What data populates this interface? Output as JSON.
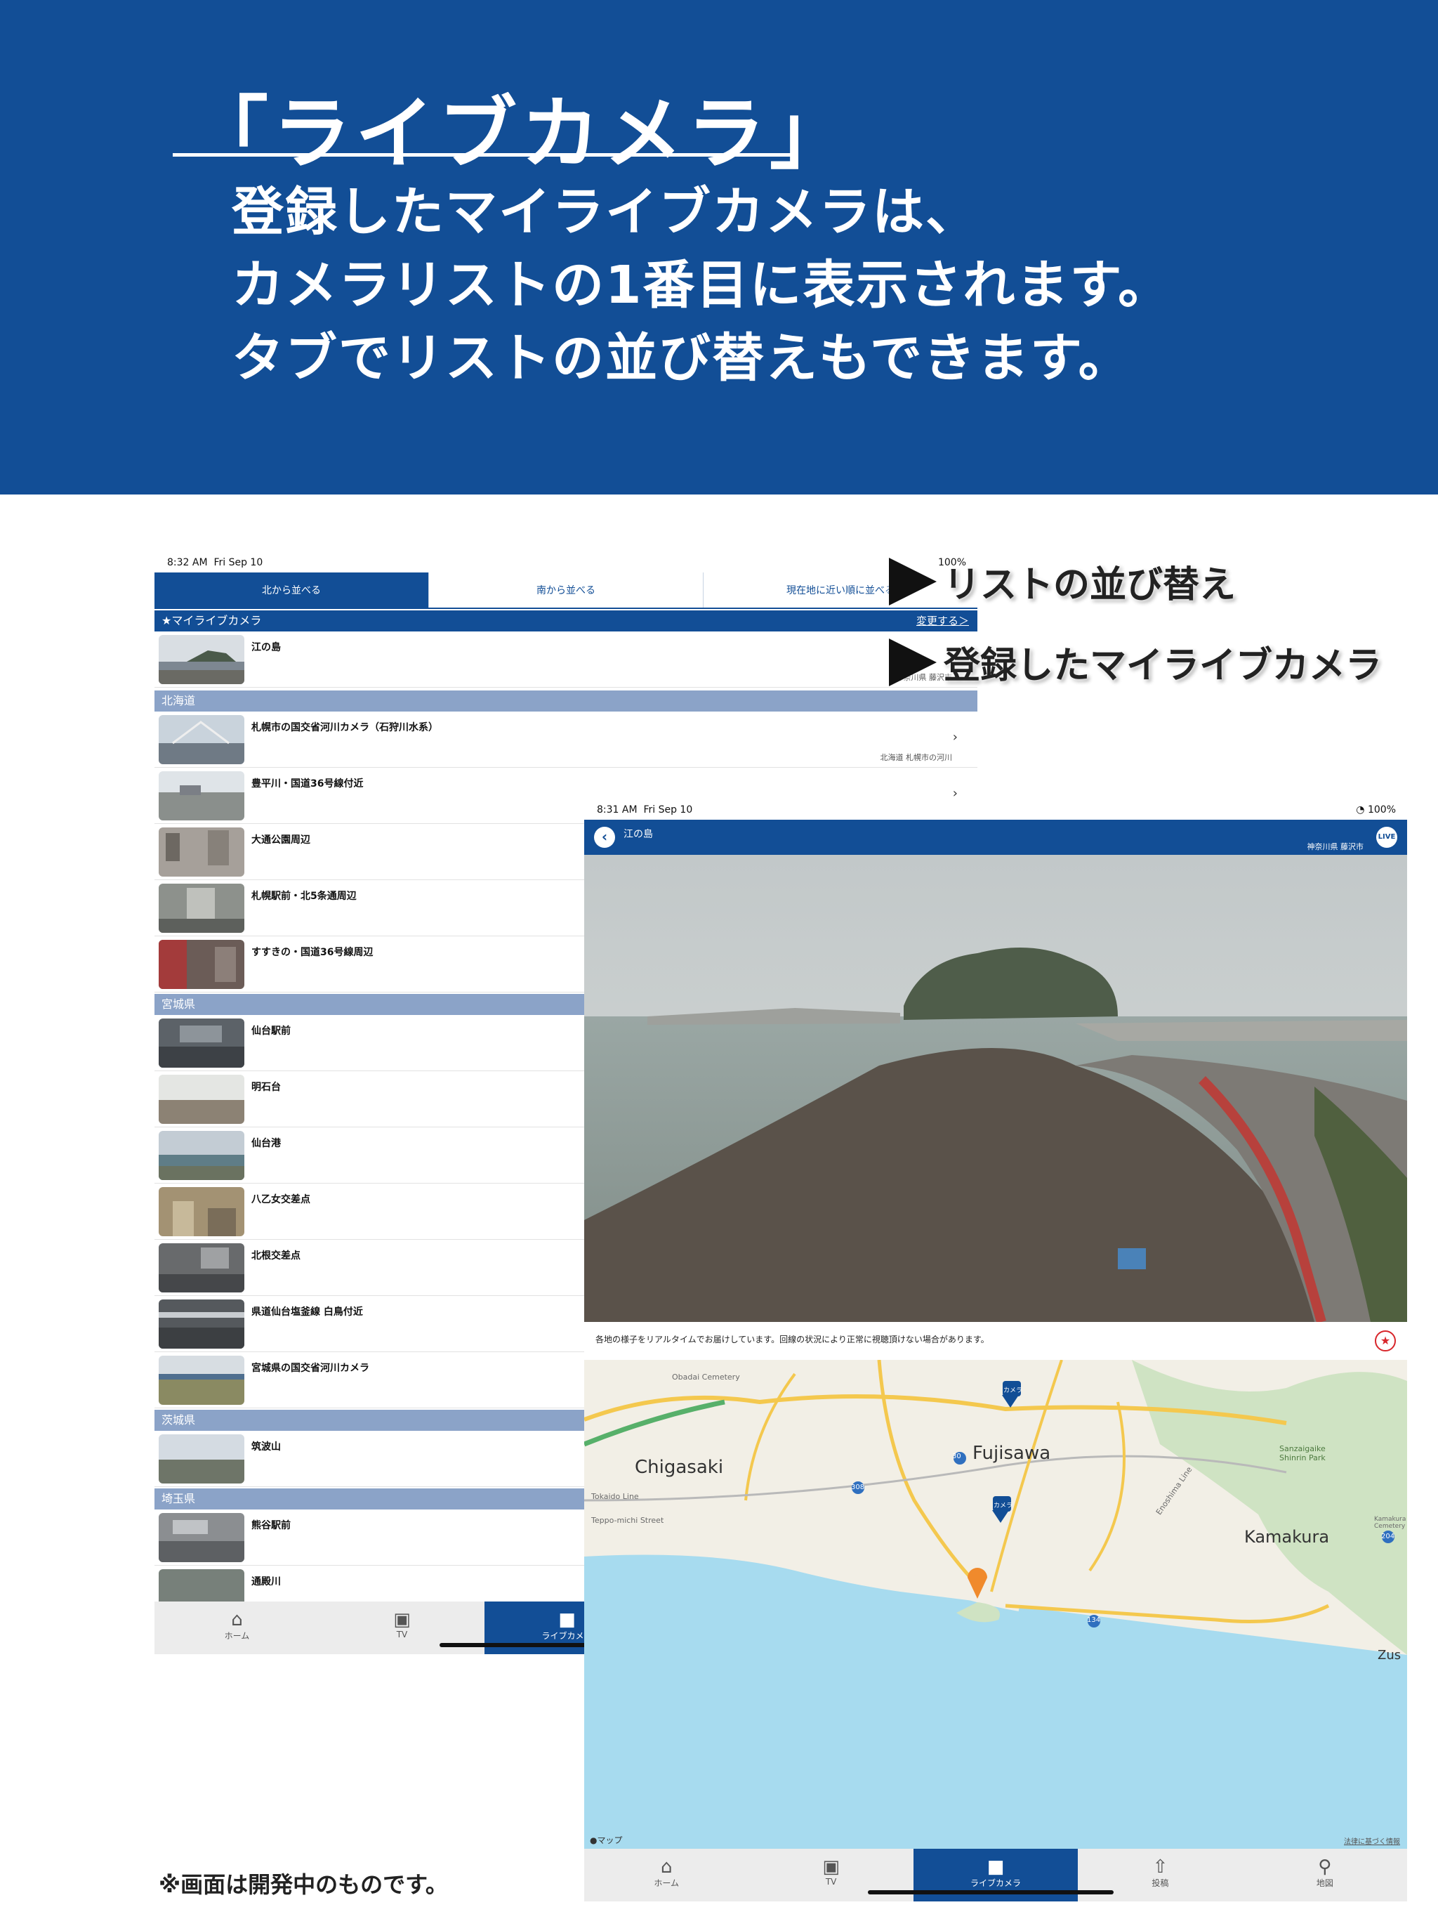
{
  "banner": {
    "title": "「ライブカメラ」",
    "lines": [
      "登録したマイライブカメラは、",
      "カメラリストの1番目に表示されます。",
      "タブでリストの並び替えもできます。"
    ]
  },
  "footnote": "※画面は開発中のものです。",
  "callouts": {
    "sort": "リストの並び替え",
    "my_camera": "登録したマイライブカメラ"
  },
  "list_screen": {
    "status_time": "8:32 AM",
    "status_date": "Fri Sep 10",
    "battery": "100%",
    "tabs": [
      "北から並べる",
      "南から並べる",
      "現在地に近い順に並べる"
    ],
    "my_section": "★マイライブカメラ",
    "edit_link": "変更する＞",
    "my_item": {
      "label": "江の島",
      "sub": "神奈川県 藤沢市"
    },
    "regions": [
      {
        "name": "北海道",
        "items": [
          {
            "label": "札幌市の国交省河川カメラ（石狩川水系）",
            "sub": "北海道 札幌市の河川"
          },
          {
            "label": "豊平川・国道36号線付近",
            "sub": ""
          },
          {
            "label": "大通公園周辺",
            "sub": ""
          },
          {
            "label": "札幌駅前・北5条通周辺",
            "sub": ""
          },
          {
            "label": "すすきの・国道36号線周辺",
            "sub": ""
          }
        ]
      },
      {
        "name": "宮城県",
        "items": [
          {
            "label": "仙台駅前",
            "sub": ""
          },
          {
            "label": "明石台",
            "sub": ""
          },
          {
            "label": "仙台港",
            "sub": ""
          },
          {
            "label": "八乙女交差点",
            "sub": ""
          },
          {
            "label": "北根交差点",
            "sub": ""
          },
          {
            "label": "県道仙台塩釜線 白鳥付近",
            "sub": ""
          },
          {
            "label": "宮城県の国交省河川カメラ",
            "sub": ""
          }
        ]
      },
      {
        "name": "茨城県",
        "items": [
          {
            "label": "筑波山",
            "sub": ""
          }
        ]
      },
      {
        "name": "埼玉県",
        "items": [
          {
            "label": "熊谷駅前",
            "sub": ""
          },
          {
            "label": "通殿川",
            "sub": ""
          }
        ]
      }
    ],
    "tabbar": [
      "ホーム",
      "TV",
      "ライブカメラ"
    ]
  },
  "detail_screen": {
    "status_time": "8:31 AM",
    "status_date": "Fri Sep 10",
    "battery": "100%",
    "title": "江の島",
    "location": "神奈川県 藤沢市",
    "live": "LIVE",
    "note": "各地の様子をリアルタイムでお届けしています。回線の状況により正常に視聴頂けない場合があります。",
    "map": {
      "labels": {
        "chigasaki": "Chigasaki",
        "fujisawa": "Fujisawa",
        "kamakura": "Kamakura",
        "zushi": "Zus",
        "obadai": "Obadai Cemetery",
        "sanzaigaike": "Sanzaigaike Shinrin Park",
        "kamakura_cem": "Kamakura Cemetery",
        "tokaido": "Tokaido Line",
        "teppo": "Teppo-michi Street",
        "enoshima_line": "Enoshima Line",
        "maps": "マップ",
        "legal": "法律に基づく情報",
        "camera_pin": "カメラ",
        "route_30": "30",
        "route_308": "308",
        "route_134": "134",
        "route_204": "204"
      }
    },
    "tabbar": [
      "ホーム",
      "TV",
      "ライブカメラ",
      "投稿",
      "地図"
    ]
  }
}
